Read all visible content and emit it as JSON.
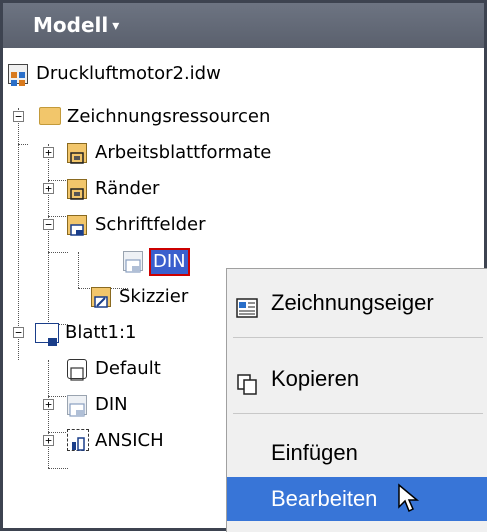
{
  "header": {
    "title": "Modell",
    "chevron": "▾"
  },
  "tree": {
    "root": "Druckluftmotor2.idw",
    "ressourcen": "Zeichnungsressourcen",
    "arbeitsblatt": "Arbeitsblattformate",
    "raender": "Ränder",
    "schriftfelder": "Schriftfelder",
    "din_selected": "DIN",
    "skizzen": "Skizzier",
    "blatt": "Blatt1:1",
    "default": "Default",
    "din": "DIN",
    "ansicht": "ANSICH",
    "expand": "+",
    "collapse": "−"
  },
  "context_menu": {
    "items": [
      {
        "label": "Zeichnungseiger",
        "icon": "drawing-properties-icon"
      },
      {
        "label": "Kopieren",
        "icon": "copy-icon"
      },
      {
        "label": "Einfügen"
      },
      {
        "label": "Bearbeiten",
        "highlighted": true
      }
    ]
  },
  "colors": {
    "header": "#5f6572",
    "highlight": "#3875d7",
    "folder": "#f2c66b"
  }
}
